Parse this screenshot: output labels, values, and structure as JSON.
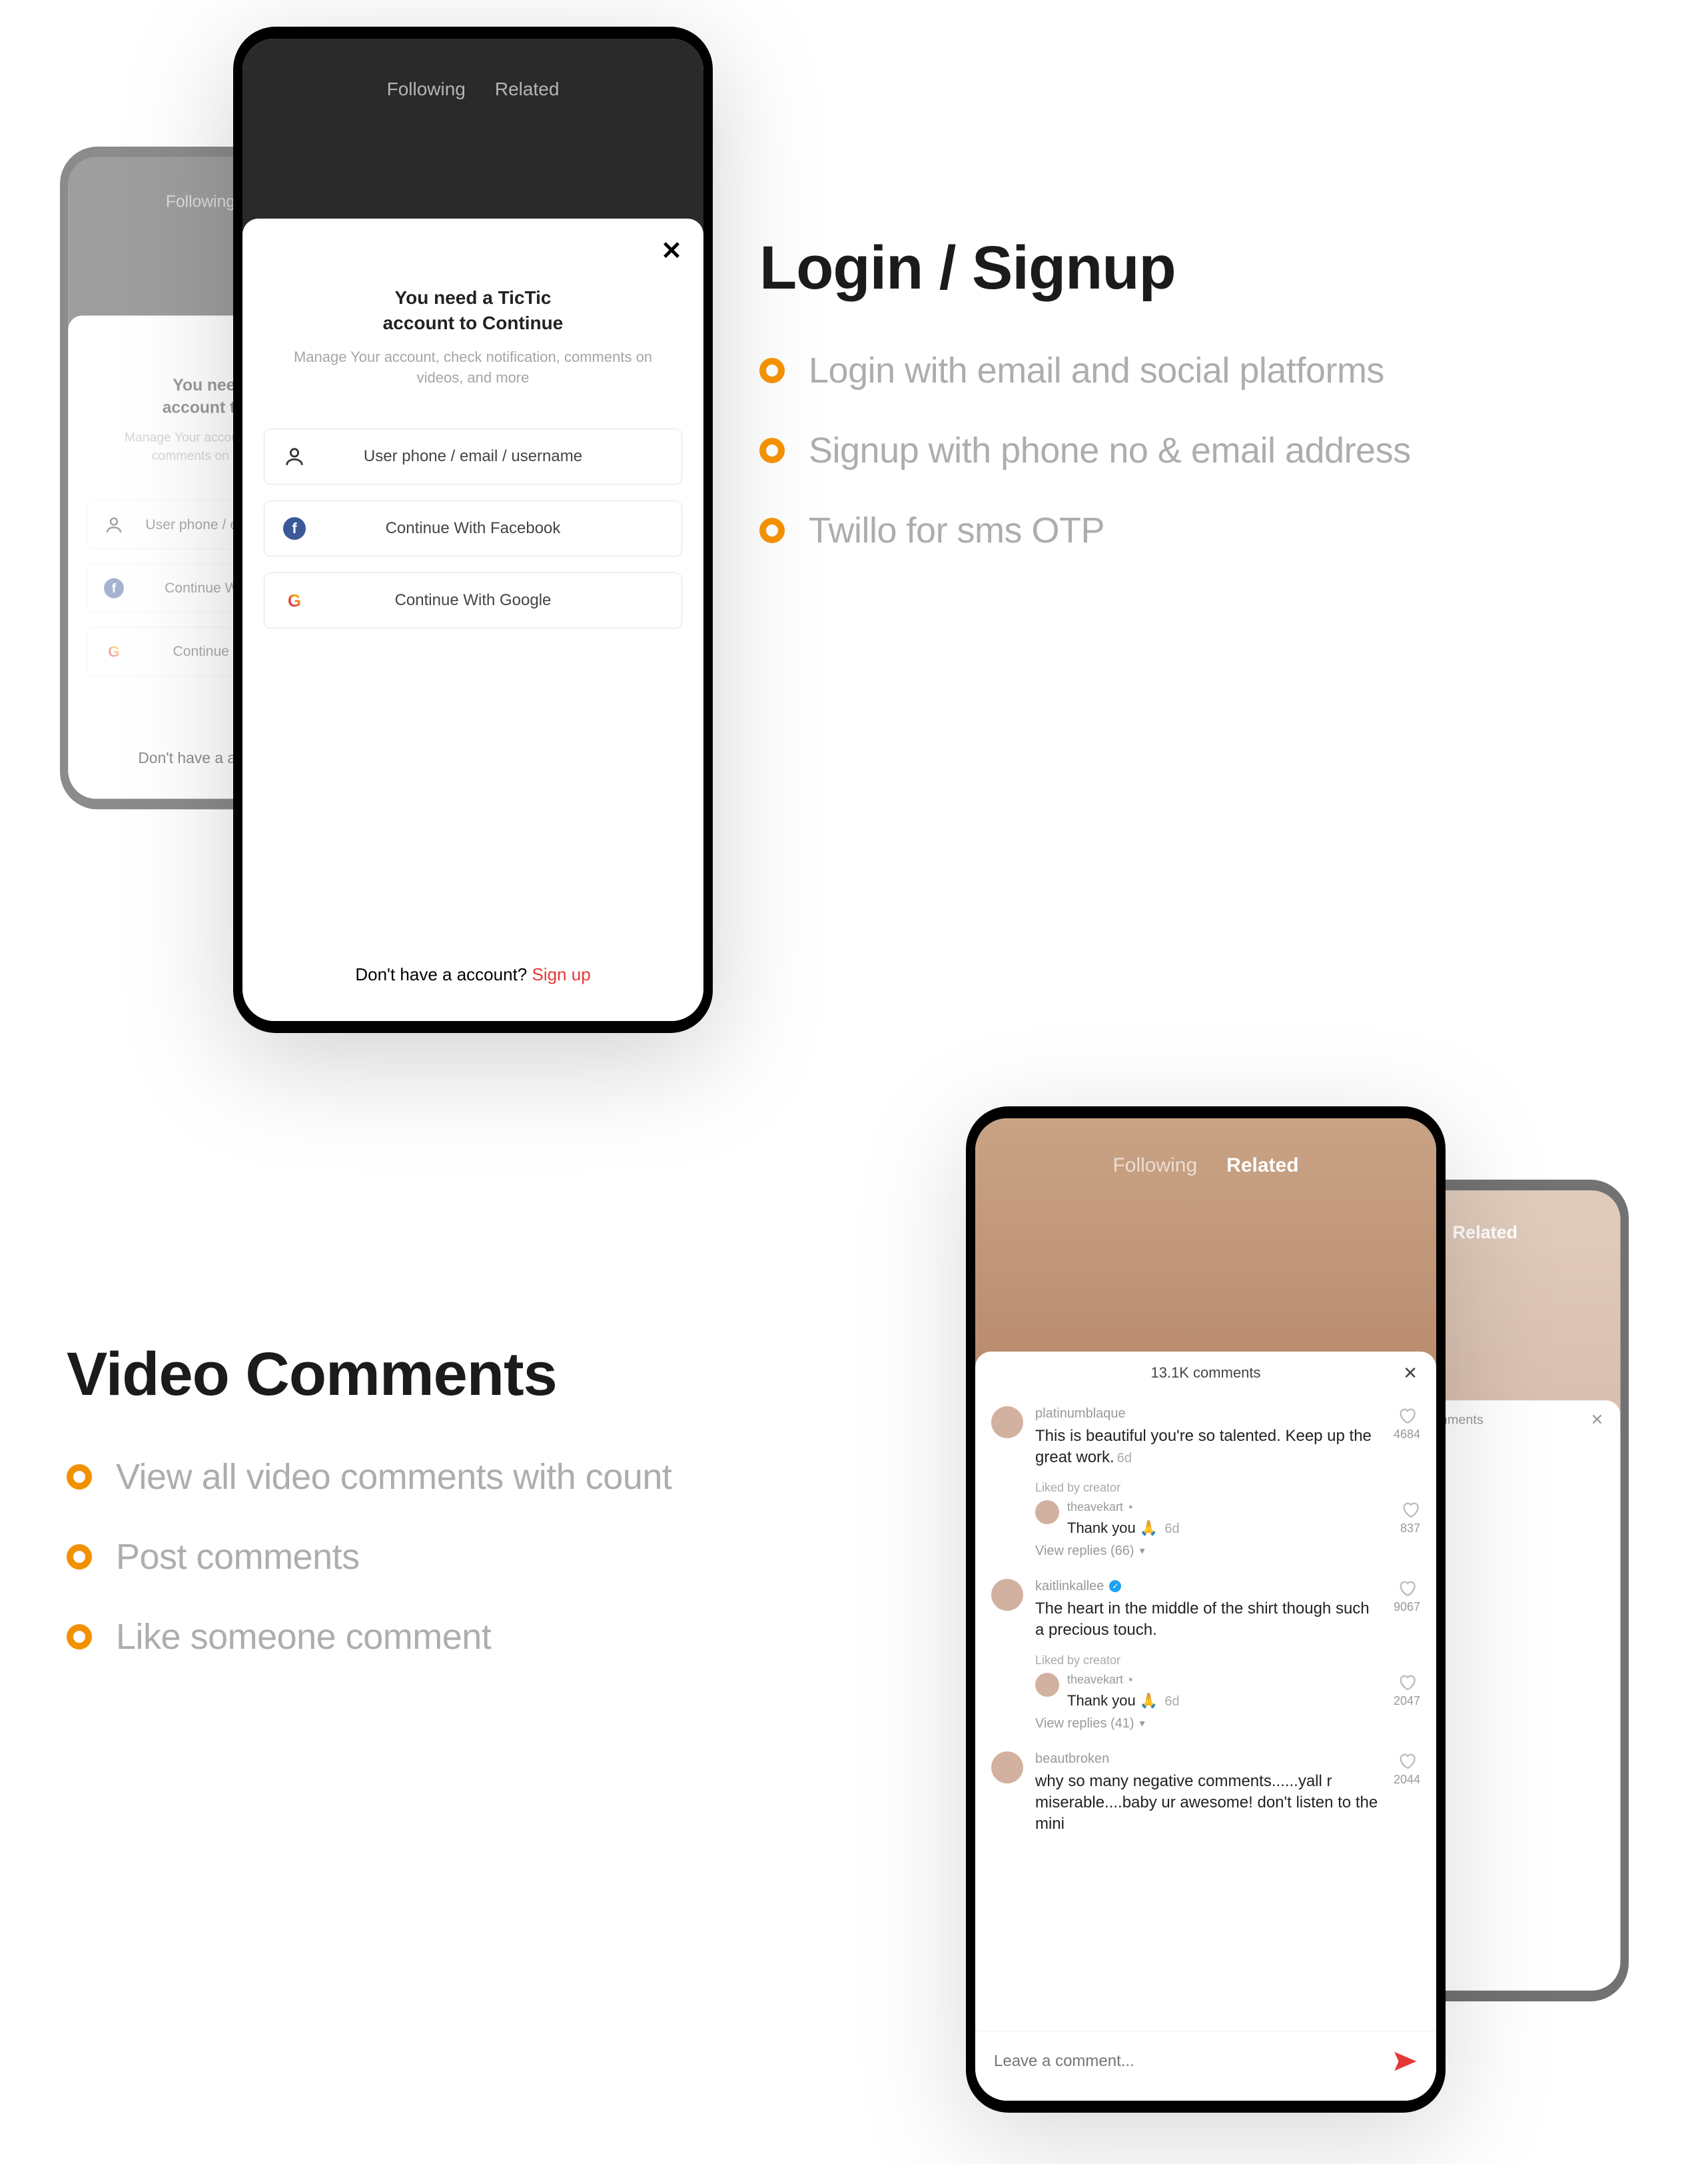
{
  "login_section": {
    "heading": "Login / Signup",
    "features": [
      "Login with email and social platforms",
      "Signup with phone no & email address",
      "Twillo for sms OTP"
    ],
    "feed_tabs": {
      "following": "Following",
      "related": "Related"
    },
    "sheet": {
      "title_l1": "You need a TicTic",
      "title_l2": "account to Continue",
      "subtitle": "Manage Your account, check notification, comments on videos, and more",
      "opt_userphone": "User phone / email / username",
      "opt_facebook": "Continue With Facebook",
      "opt_google": "Continue With Google",
      "footer_prompt": "Don't have a account? ",
      "footer_link": "Sign up"
    }
  },
  "comments_section": {
    "heading": "Video Comments",
    "features": [
      "View all video comments with count",
      "Post comments",
      "Like someone comment"
    ],
    "feed_tabs": {
      "following": "Following",
      "related": "Related"
    },
    "header_count": "13.1K comments",
    "liked_by_creator": "Liked by creator",
    "input_placeholder": "Leave a comment...",
    "comments": [
      {
        "user": "platinumblaque",
        "text": "This is beautiful you're so talented. Keep up the great work.",
        "age": "6d",
        "likes": "4684",
        "reply": {
          "user": "theavekart",
          "text": "Thank you 🙏",
          "age": "6d",
          "likes": "837"
        },
        "view_replies": "View replies (66)"
      },
      {
        "user": "kaitlinkallee",
        "verified": true,
        "text": "The heart in the middle of the shirt though such a precious touch.",
        "age": "",
        "likes": "9067",
        "reply": {
          "user": "theavekart",
          "text": "Thank you 🙏",
          "age": "6d",
          "likes": "2047"
        },
        "view_replies": "View replies (41)"
      },
      {
        "user": "beautbroken",
        "text": "why so many negative comments......yall r miserable....baby ur awesome! don't listen to the mini",
        "age": "",
        "likes": "2044"
      }
    ]
  }
}
